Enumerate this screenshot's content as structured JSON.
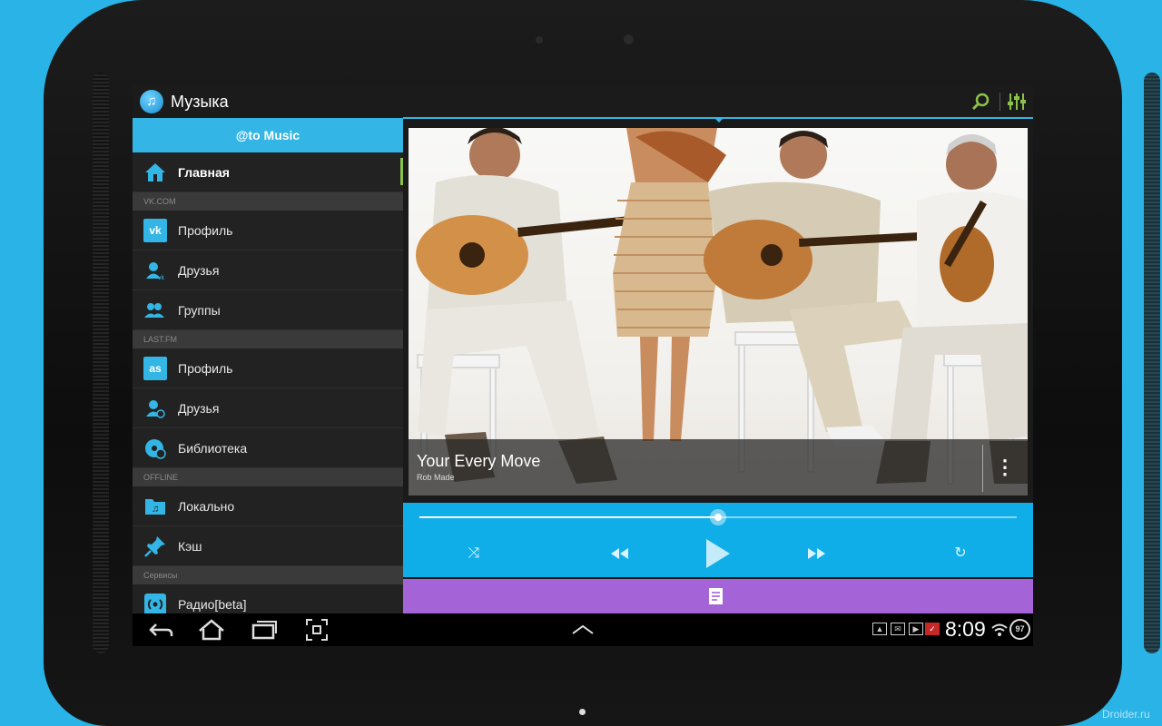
{
  "app": {
    "title": "Музыка"
  },
  "drawer": {
    "header": "@to Music",
    "main_item": {
      "label": "Главная",
      "icon": "home-icon"
    },
    "sections": [
      {
        "title": "VK.COM",
        "items": [
          {
            "label": "Профиль",
            "icon": "vk-icon"
          },
          {
            "label": "Друзья",
            "icon": "vk-friends-icon"
          },
          {
            "label": "Группы",
            "icon": "vk-groups-icon"
          }
        ]
      },
      {
        "title": "LAST.FM",
        "items": [
          {
            "label": "Профиль",
            "icon": "lastfm-icon"
          },
          {
            "label": "Друзья",
            "icon": "lastfm-friends-icon"
          },
          {
            "label": "Библиотека",
            "icon": "library-icon"
          }
        ]
      },
      {
        "title": "OFFLINE",
        "items": [
          {
            "label": "Локально",
            "icon": "local-folder-icon"
          },
          {
            "label": "Кэш",
            "icon": "pin-icon"
          }
        ]
      },
      {
        "title": "Сервисы",
        "items": [
          {
            "label": "Радио[beta]",
            "icon": "radio-icon"
          }
        ]
      }
    ]
  },
  "now_playing": {
    "song": "Your Every Move",
    "artist": "Rob Made",
    "progress": 0.5
  },
  "status": {
    "time": "8:09",
    "battery": "97"
  },
  "colors": {
    "accent": "#33b5e5",
    "player": "#10aee8",
    "lyrics": "#a463d6",
    "highlight": "#8bc34a"
  },
  "watermark": "Droider.ru"
}
